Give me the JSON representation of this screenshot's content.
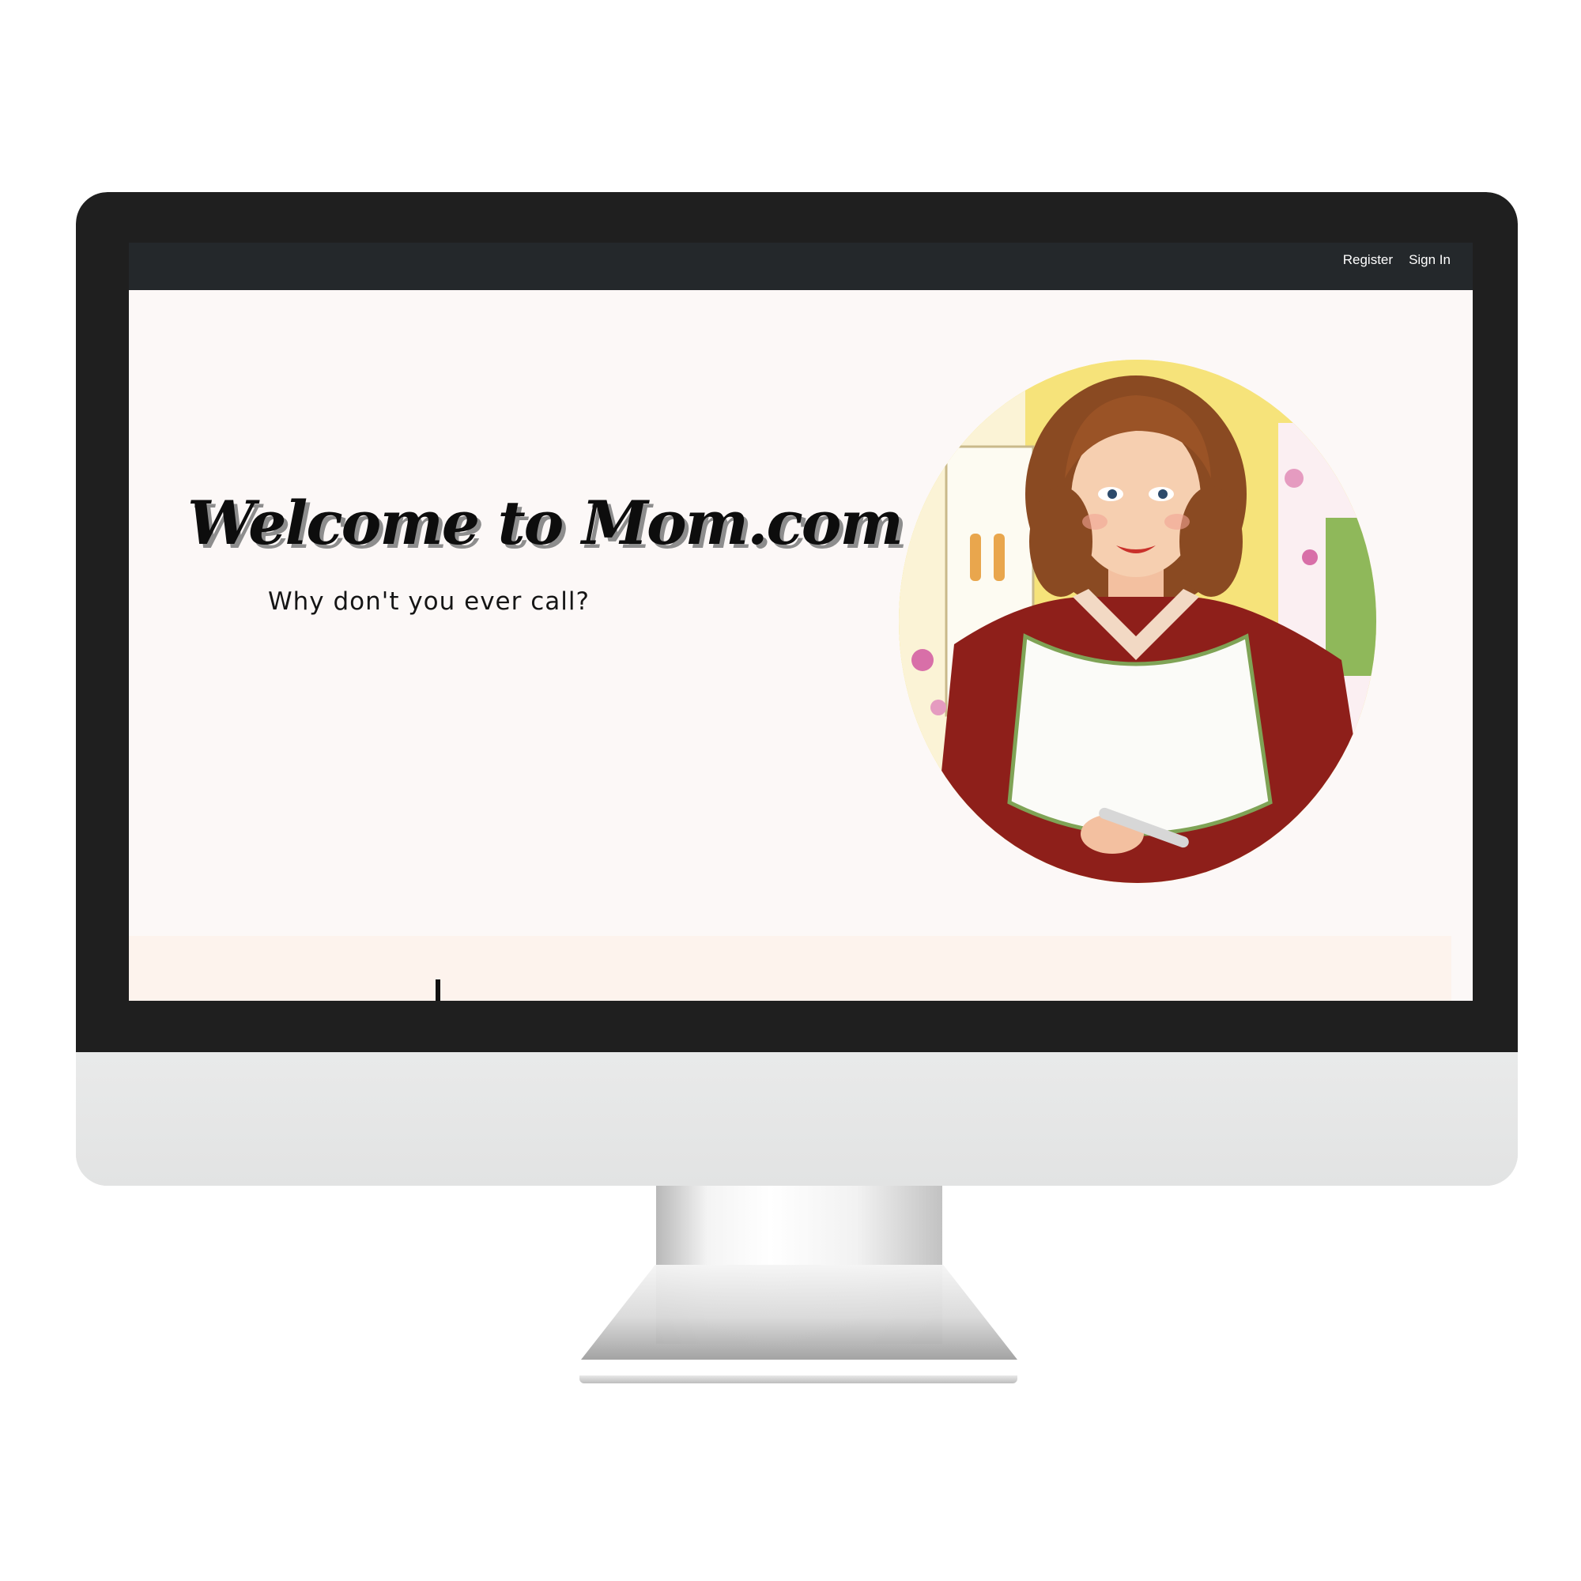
{
  "navbar": {
    "register_label": "Register",
    "signin_label": "Sign In"
  },
  "hero": {
    "title": "Welcome to Mom.com",
    "subtitle": "Why don't you ever call?"
  },
  "colors": {
    "navbar_bg": "#24282b",
    "page_bg": "#fcf8f7",
    "strip_bg": "#fdf3ed",
    "bezel": "#1f1f1f",
    "chin": "#e6e7e6"
  },
  "images": {
    "portrait": "retro-housewife-illustration"
  }
}
